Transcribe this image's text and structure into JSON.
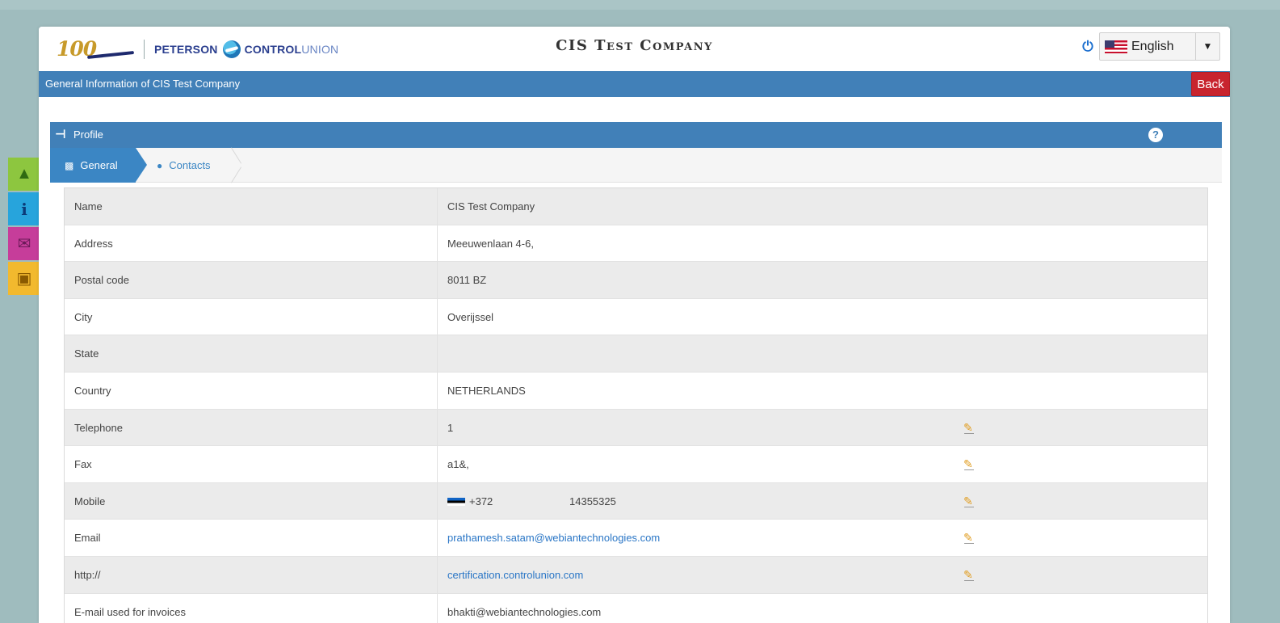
{
  "header": {
    "logo_anniversary": "100",
    "brand_part1": "PETERSON",
    "brand_part2": "CONTROL",
    "brand_part3": "UNION",
    "company_title": "CIS Test Company",
    "language": "English"
  },
  "page": {
    "title": "General Information of CIS Test Company",
    "back_label": "Back"
  },
  "profile": {
    "label": "Profile",
    "help": "?"
  },
  "tabs": [
    {
      "label": "General",
      "active": true
    },
    {
      "label": "Contacts",
      "active": false
    }
  ],
  "fields": [
    {
      "label": "Name",
      "value": "CIS Test Company",
      "editable": false
    },
    {
      "label": "Address",
      "value": "Meeuwenlaan 4-6,",
      "editable": false
    },
    {
      "label": "Postal code",
      "value": "8011 BZ",
      "editable": false
    },
    {
      "label": "City",
      "value": "Overijssel",
      "editable": false
    },
    {
      "label": "State",
      "value": "",
      "editable": false
    },
    {
      "label": "Country",
      "value": "NETHERLANDS",
      "editable": false
    },
    {
      "label": "Telephone",
      "value": "1",
      "editable": true
    },
    {
      "label": "Fax",
      "value": "a1&,",
      "editable": true
    },
    {
      "label": "Mobile",
      "value": "+372",
      "number": "14355325",
      "editable": true
    },
    {
      "label": "Email",
      "value": "prathamesh.satam@webiantechnologies.com",
      "editable": true,
      "link": true
    },
    {
      "label": "http://",
      "value": "certification.controlunion.com",
      "editable": true,
      "link": true
    },
    {
      "label": "E-mail used for invoices",
      "value": "bhakti@webiantechnologies.com",
      "editable": false
    }
  ],
  "sidebar": [
    "home-icon",
    "info-icon",
    "mail-icon",
    "folder-icon"
  ],
  "colors": {
    "accent": "#4180b8",
    "back": "#c8242e",
    "link": "#2a76c6",
    "background": "#9fbcbe"
  }
}
